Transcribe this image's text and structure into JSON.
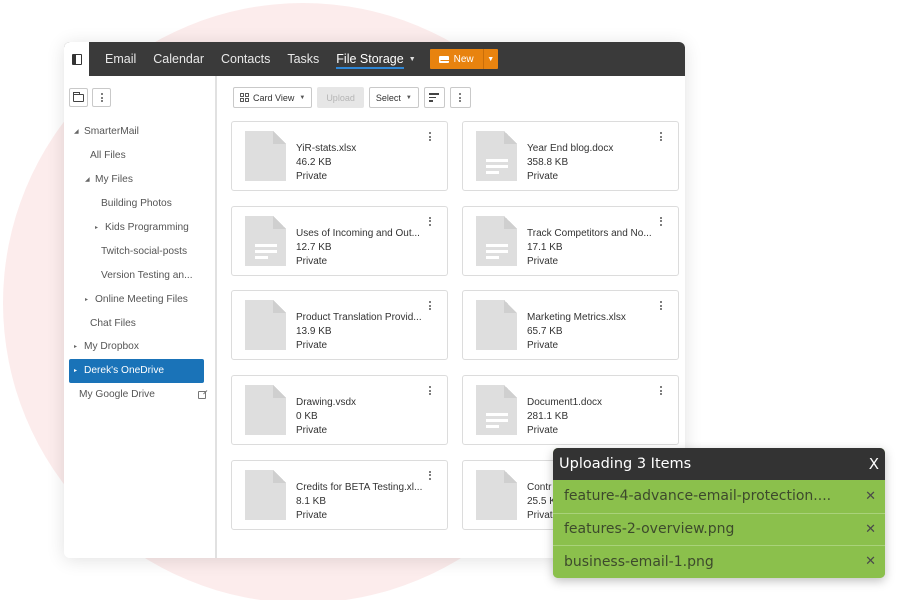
{
  "topbar": {
    "nav": [
      {
        "label": "Email"
      },
      {
        "label": "Calendar"
      },
      {
        "label": "Contacts"
      },
      {
        "label": "Tasks"
      },
      {
        "label": "File Storage",
        "active": true
      }
    ],
    "new_label": "New",
    "new_button_color": "#e8830f",
    "bar_color": "#3a3a3a"
  },
  "sidebar": {
    "tree": [
      {
        "label": "SmarterMail",
        "arrow": "◢",
        "level": 0
      },
      {
        "label": "All Files",
        "arrow": "",
        "level": 1
      },
      {
        "label": "My Files",
        "arrow": "◢",
        "level": 1
      },
      {
        "label": "Building Photos",
        "arrow": "",
        "level": 2
      },
      {
        "label": "Kids Programming",
        "arrow": "▸",
        "level": 2
      },
      {
        "label": "Twitch-social-posts",
        "arrow": "",
        "level": 2
      },
      {
        "label": "Version Testing an...",
        "arrow": "",
        "level": 2
      },
      {
        "label": "Online Meeting Files",
        "arrow": "▸",
        "level": 1
      },
      {
        "label": "Chat Files",
        "arrow": "",
        "level": 1
      },
      {
        "label": "My Dropbox",
        "arrow": "▸",
        "level": 0
      },
      {
        "label": "Derek's OneDrive",
        "arrow": "▸",
        "level": 0,
        "selected": true
      },
      {
        "label": "My Google Drive",
        "arrow": "",
        "level": 0,
        "external": true
      }
    ],
    "selected_color": "#1a73b8"
  },
  "toolbar": {
    "view_label": "Card View",
    "upload_label": "Upload",
    "select_label": "Select"
  },
  "files": [
    {
      "name": "YiR-stats.xlsx",
      "size": "46.2 KB",
      "sharing": "Private",
      "type": "blank"
    },
    {
      "name": "Year End blog.docx",
      "size": "358.8 KB",
      "sharing": "Private",
      "type": "doc"
    },
    {
      "name": "Uses of Incoming and Out...",
      "size": "12.7 KB",
      "sharing": "Private",
      "type": "doc"
    },
    {
      "name": "Track Competitors and No...",
      "size": "17.1 KB",
      "sharing": "Private",
      "type": "doc"
    },
    {
      "name": "Product Translation Provid...",
      "size": "13.9 KB",
      "sharing": "Private",
      "type": "blank"
    },
    {
      "name": "Marketing Metrics.xlsx",
      "size": "65.7 KB",
      "sharing": "Private",
      "type": "blank"
    },
    {
      "name": "Drawing.vsdx",
      "size": "0 KB",
      "sharing": "Private",
      "type": "blank"
    },
    {
      "name": "Document1.docx",
      "size": "281.1 KB",
      "sharing": "Private",
      "type": "doc"
    },
    {
      "name": "Credits for BETA Testing.xl...",
      "size": "8.1 KB",
      "sharing": "Private",
      "type": "blank"
    },
    {
      "name": "Contr",
      "size": "25.5 K",
      "sharing": "Privat",
      "type": "blank"
    }
  ],
  "upload_panel": {
    "title": "Uploading 3 Items",
    "close_label": "X",
    "items": [
      {
        "name": "feature-4-advance-email-protection...."
      },
      {
        "name": "features-2-overview.png"
      },
      {
        "name": "business-email-1.png"
      }
    ],
    "item_close": "✕",
    "item_color": "#8bc04c"
  }
}
